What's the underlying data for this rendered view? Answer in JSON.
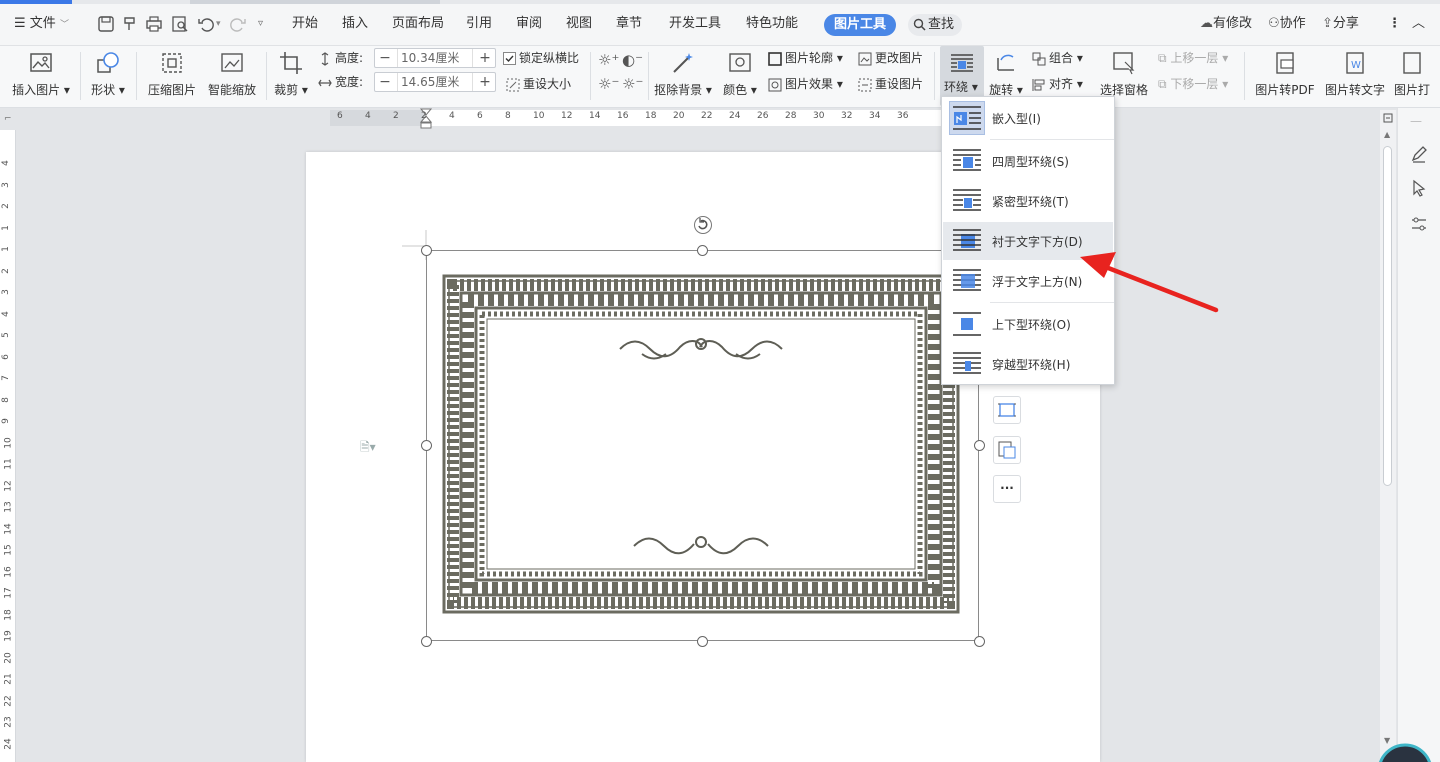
{
  "menu": {
    "file_label": "文件",
    "tabs": [
      "开始",
      "插入",
      "页面布局",
      "引用",
      "审阅",
      "视图",
      "章节",
      "开发工具",
      "特色功能"
    ],
    "active_tab": "图片工具",
    "search_label": "查找",
    "right": {
      "modified": "有修改",
      "collab": "协作",
      "share": "分享"
    }
  },
  "ribbon": {
    "insert_picture": "插入图片",
    "shape": "形状",
    "compress": "压缩图片",
    "smart_zoom": "智能缩放",
    "crop": "裁剪",
    "height_label": "高度:",
    "height_value": "10.34厘米",
    "width_label": "宽度:",
    "width_value": "14.65厘米",
    "lock_ratio": "锁定纵横比",
    "reset_size": "重设大小",
    "remove_bg": "抠除背景",
    "color": "颜色",
    "outline": "图片轮廓",
    "effect": "图片效果",
    "change_picture": "更改图片",
    "reset_picture": "重设图片",
    "wrap": "环绕",
    "rotate": "旋转",
    "group": "组合",
    "align": "对齐",
    "selection_pane": "选择窗格",
    "bring_forward": "上移一层",
    "send_backward": "下移一层",
    "to_pdf": "图片转PDF",
    "to_text": "图片转文字",
    "to_more": "图片打"
  },
  "ruler": {
    "h_ticks": [
      "6",
      "4",
      "2",
      "2",
      "4",
      "6",
      "8",
      "10",
      "12",
      "14",
      "16",
      "18",
      "20",
      "22",
      "24",
      "26",
      "28",
      "30",
      "32",
      "34",
      "36"
    ],
    "v_ticks": [
      "4",
      "3",
      "2",
      "1",
      "1",
      "2",
      "3",
      "4",
      "5",
      "6",
      "7",
      "8",
      "9",
      "10",
      "11",
      "12",
      "13",
      "14",
      "15",
      "16",
      "17",
      "18",
      "19",
      "20",
      "21",
      "22",
      "23",
      "24"
    ]
  },
  "wrap_menu": {
    "items": [
      {
        "label": "嵌入型(I)",
        "active": true
      },
      {
        "label": "四周型环绕(S)",
        "active": false
      },
      {
        "label": "紧密型环绕(T)",
        "active": false
      },
      {
        "label": "衬于文字下方(D)",
        "active": false,
        "hovered": true
      },
      {
        "label": "浮于文字上方(N)",
        "active": false
      },
      {
        "label": "上下型环绕(O)",
        "active": false
      },
      {
        "label": "穿越型环绕(H)",
        "active": false
      }
    ]
  },
  "colors": {
    "accent": "#4a87e6",
    "annotation_arrow": "#e8231f",
    "frame": "#6b6b60"
  }
}
